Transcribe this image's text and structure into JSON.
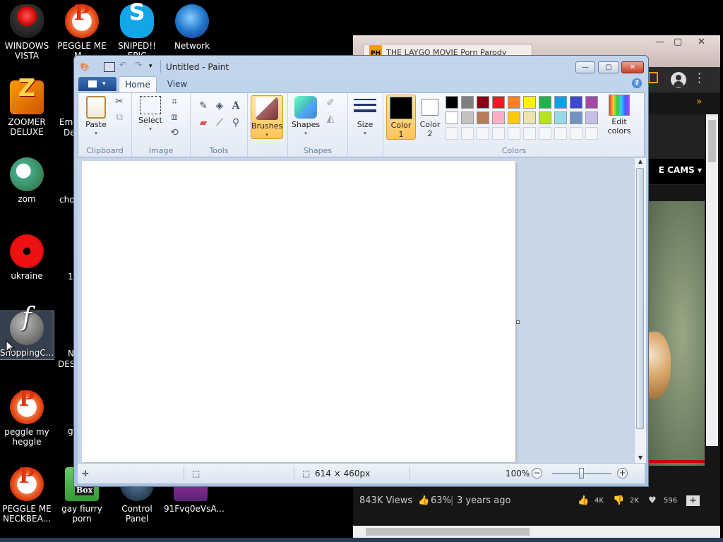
{
  "desktop": {
    "icons": [
      {
        "label": "WINDOWS VISTA"
      },
      {
        "label": "PEGGLE ME M..."
      },
      {
        "label": "SNIPED!! EPIC"
      },
      {
        "label": "Network"
      },
      {
        "label": "ZOOMER DELUXE"
      },
      {
        "label": "Emb..."
      },
      {
        "label": "zom"
      },
      {
        "label": "cho..."
      },
      {
        "label": "ukraine"
      },
      {
        "label": "ShoppingC..."
      },
      {
        "label": "peggle my heggle"
      },
      {
        "label": "PEGGLE ME NECKBEA..."
      },
      {
        "label": "gay fiurry porn"
      },
      {
        "label": "Control Panel"
      },
      {
        "label": "91Fvq0eVsA..."
      }
    ],
    "partial_labels": [
      "De",
      "1",
      "N",
      "DES",
      "g"
    ]
  },
  "browser": {
    "tab_badge": "PH",
    "tab_title": "THE LAYGO MOVIE Porn Parody",
    "tab_close": "×",
    "cams_label": "E CAMS",
    "chevron": "»",
    "views": "843K Views",
    "rating": "63%",
    "age": "3 years ago",
    "likes": "4K",
    "dislikes": "2K",
    "favs": "596",
    "plus": "+"
  },
  "paint": {
    "title": "Untitled - Paint",
    "tabs": {
      "home": "Home",
      "view": "View"
    },
    "help": "?",
    "groups": {
      "clipboard": "Clipboard",
      "image": "Image",
      "tools": "Tools",
      "shapes": "Shapes",
      "colors": "Colors"
    },
    "buttons": {
      "paste": "Paste",
      "select": "Select",
      "brushes": "Brushes",
      "shapes": "Shapes",
      "size": "Size",
      "color1_a": "Color",
      "color1_b": "1",
      "color2_a": "Color",
      "color2_b": "2",
      "edit_a": "Edit",
      "edit_b": "colors"
    },
    "color1": "#000000",
    "color2": "#ffffff",
    "palette_row1": [
      "#000000",
      "#7f7f7f",
      "#880015",
      "#ed1c24",
      "#ff7f27",
      "#fff200",
      "#22b14c",
      "#00a2e8",
      "#3f48cc",
      "#a349a4"
    ],
    "palette_row2": [
      "#ffffff",
      "#c3c3c3",
      "#b97a57",
      "#ffaec9",
      "#ffc90e",
      "#efe4b0",
      "#b5e61d",
      "#99d9ea",
      "#7092be",
      "#c8bfe7"
    ],
    "status": {
      "dimensions": "614 × 460px",
      "zoom": "100%"
    }
  }
}
